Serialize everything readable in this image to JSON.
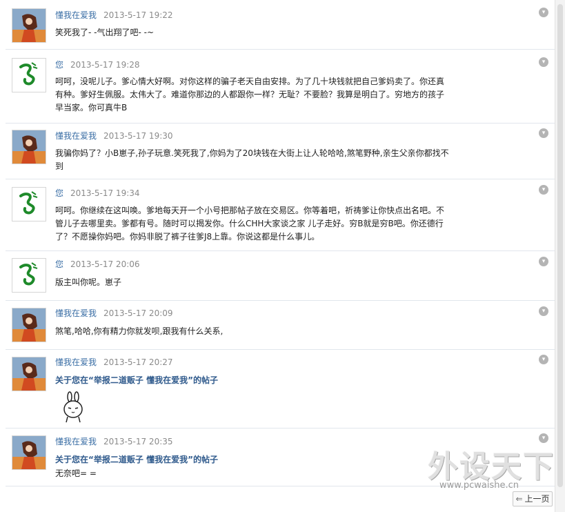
{
  "messages": [
    {
      "name": "懂我在爱我",
      "time": "2013-5-17 19:22",
      "avatar": "anime",
      "lines": [
        "笑死我了- -气出翔了吧- -~"
      ]
    },
    {
      "name": "您",
      "time": "2013-5-17 19:28",
      "avatar": "snake",
      "lines": [
        "呵呵，没呢儿子。爹心情大好啊。对你这样的骗子老天自由安排。为了几十块钱就把自己爹妈卖了。你还真",
        "有种。爹好生佩服。太伟大了。难道你那边的人都跟你一样？无耻？不要脸？我算是明白了。穷地方的孩子",
        "早当家。你可真牛B"
      ]
    },
    {
      "name": "懂我在爱我",
      "time": "2013-5-17 19:30",
      "avatar": "anime",
      "lines": [
        "我骗你妈了？小B崽子,孙子玩意.笑死我了,你妈为了20块钱在大街上让人轮哈哈,煞笔野种,亲生父亲你都找不",
        "到"
      ]
    },
    {
      "name": "您",
      "time": "2013-5-17 19:34",
      "avatar": "snake",
      "lines": [
        "呵呵。你继续在这叫唤。爹地每天开一个小号把那帖子放在交易区。你等着吧，祈祷爹让你快点出名吧。不",
        "管儿子去哪里卖。爹都有号。随时可以揭发你。什么CHH大家谈之家 儿子走好。穷B就是穷B吧。你还德行",
        "了？不愿操你妈吧。你妈非脱了裤子往爹J8上靠。你说这都是什么事儿。"
      ]
    },
    {
      "name": "您",
      "time": "2013-5-17 20:06",
      "avatar": "snake",
      "lines": [
        "版主叫你呢。崽子"
      ]
    },
    {
      "name": "懂我在爱我",
      "time": "2013-5-17 20:09",
      "avatar": "anime",
      "lines": [
        "煞笔,哈哈,你有精力你就发呗,跟我有什么关系,"
      ]
    },
    {
      "name": "懂我在爱我",
      "time": "2013-5-17 20:27",
      "avatar": "anime",
      "subject": "关于您在“举报二道贩子 懂我在爱我”的帖子",
      "lines": [],
      "sticker": "rabbit-emoticon"
    },
    {
      "name": "懂我在爱我",
      "time": "2013-5-17 20:35",
      "avatar": "anime",
      "subject": "关于您在“举报二道贩子 懂我在爱我”的帖子",
      "lines": [
        "无奈吧= ="
      ]
    }
  ],
  "collapse_icon": "▾",
  "watermark": {
    "title": "外设天下",
    "url": "www.pcwaishe.cn"
  },
  "pager": {
    "prev_label": "上一页",
    "prev_icon": "⇐"
  },
  "colors": {
    "name_link": "#3a6ea5",
    "subject": "#2f5a8c",
    "timestamp": "#8a8a8a",
    "separator": "#e1e6ec"
  }
}
